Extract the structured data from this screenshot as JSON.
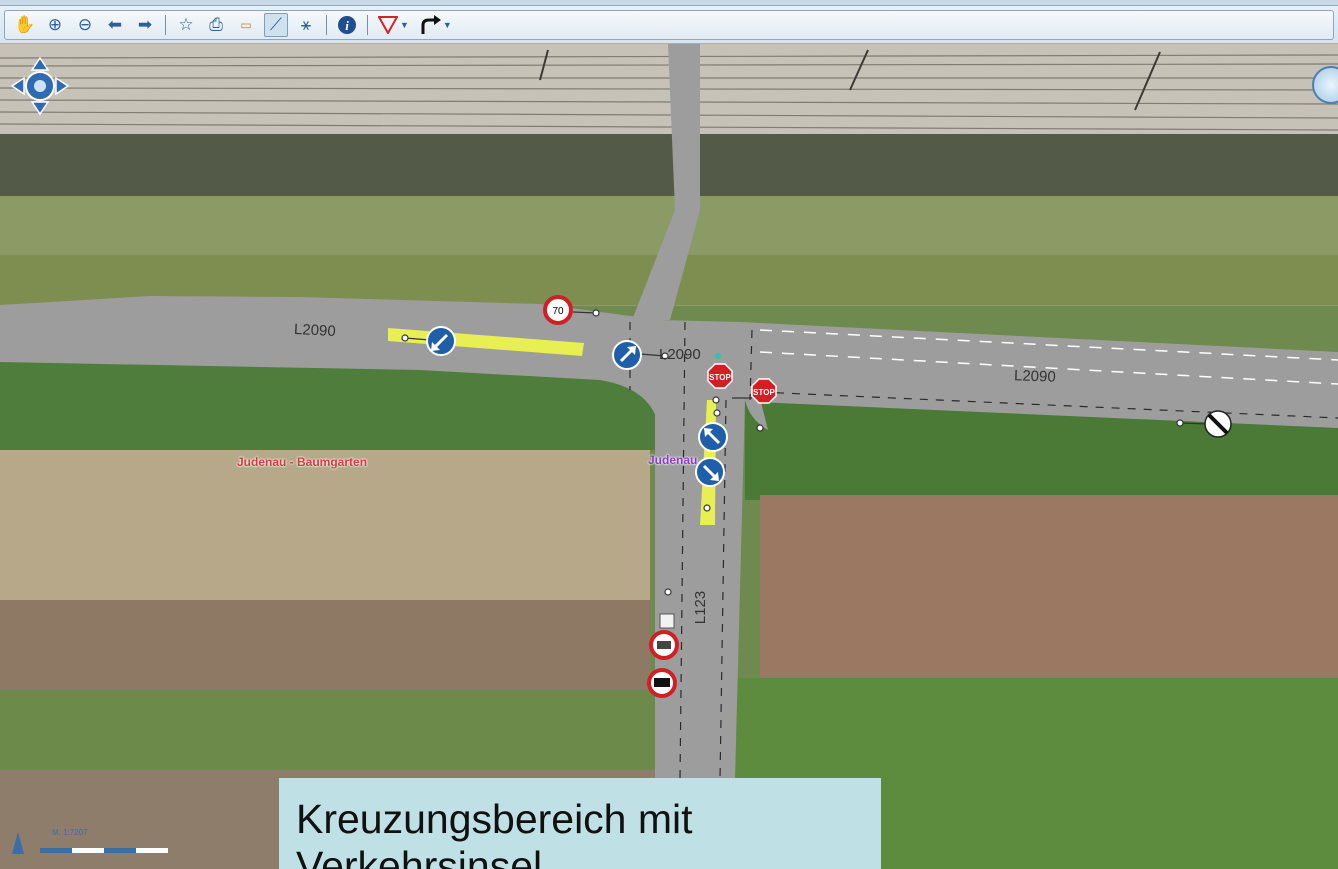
{
  "toolbar": {
    "tools": [
      {
        "name": "pan-hand-icon",
        "glyph": "✋"
      },
      {
        "name": "zoom-in-icon",
        "glyph": "⊕"
      },
      {
        "name": "zoom-out-icon",
        "glyph": "⊖"
      },
      {
        "name": "back-arrow-icon",
        "glyph": "⬅"
      },
      {
        "name": "forward-arrow-icon",
        "glyph": "➡"
      },
      {
        "name": "favorite-star-icon",
        "glyph": "☆"
      },
      {
        "name": "print-icon",
        "glyph": "⎙"
      },
      {
        "name": "measure-ruler-icon",
        "glyph": "📏"
      },
      {
        "name": "draw-line-icon",
        "glyph": "⟋"
      },
      {
        "name": "route-icon",
        "glyph": "⚹"
      },
      {
        "name": "info-icon",
        "glyph": "ℹ"
      },
      {
        "name": "yield-filter-icon",
        "glyph": "▽"
      },
      {
        "name": "turn-arrow-icon",
        "glyph": "↱"
      }
    ],
    "active_tool": "draw-line-icon"
  },
  "map": {
    "road_labels": [
      "L2090",
      "L2090",
      "L2090",
      "L123"
    ],
    "place_labels": [
      "Judenau - Baumgarten",
      "Judenau"
    ],
    "speed_limit": "70",
    "stop_sign_text": "STOP",
    "scale_text": "M. 1:7207"
  },
  "caption": {
    "text": "Kreuzungsbereich mit Verkehrsinsel"
  },
  "colors": {
    "road": "#9d9d9d",
    "island": "#e7ef52",
    "mandatory_sign": "#1f5ea8",
    "stop_sign": "#d21e24",
    "caption_bg": "#bfe1e5"
  }
}
